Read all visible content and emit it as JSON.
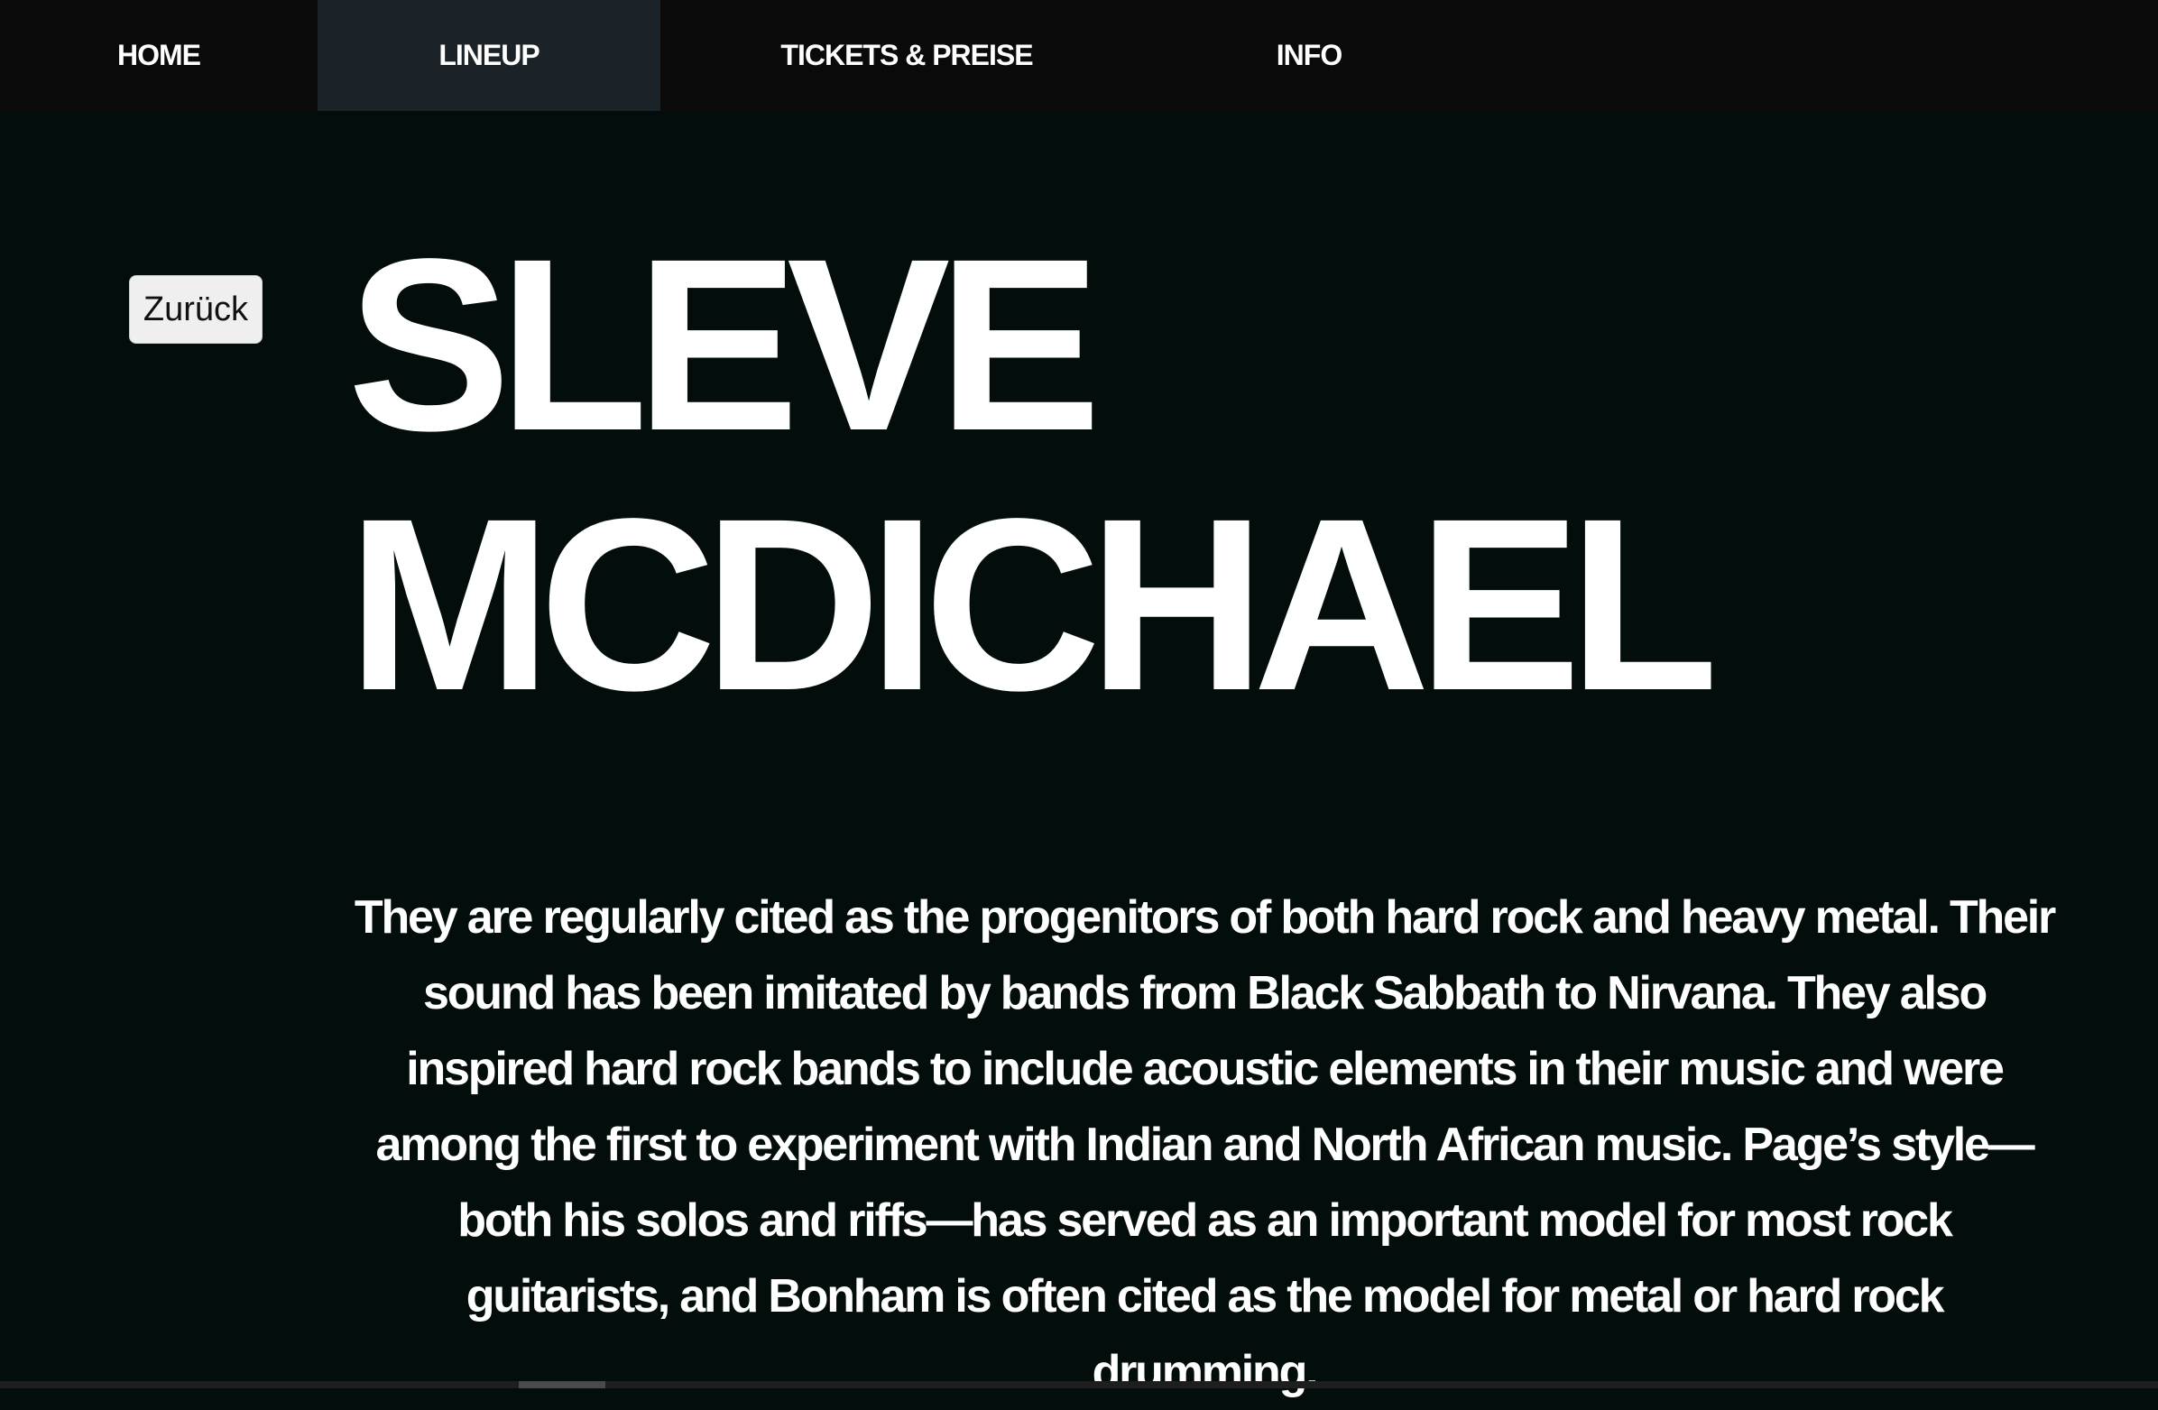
{
  "nav": {
    "items": [
      {
        "label": "HOME"
      },
      {
        "label": "LINEUP",
        "active": true
      },
      {
        "label": "TICKETS & PREISE"
      },
      {
        "label": "INFO"
      }
    ]
  },
  "back_button": {
    "label": "Zurück"
  },
  "artist": {
    "name_line1": "SLEVE",
    "name_line2": "MCDICHAEL",
    "bio": "They are regularly cited as the progenitors of both hard rock and heavy metal. Their sound has been imitated by bands from Black Sabbath to Nirvana. They also inspired hard rock bands to include acoustic elements in their music and were among the first to experiment with Indian and North African music. Page’s style—both his solos and riffs—has served as an important model for most rock guitarists, and Bonham is often cited as the model for metal or hard rock drumming."
  },
  "colors": {
    "background": "#020d0c",
    "nav_background": "#0a0a0a",
    "nav_active_background": "#1b2329",
    "text": "#ffffff",
    "button_background": "#efefef"
  }
}
